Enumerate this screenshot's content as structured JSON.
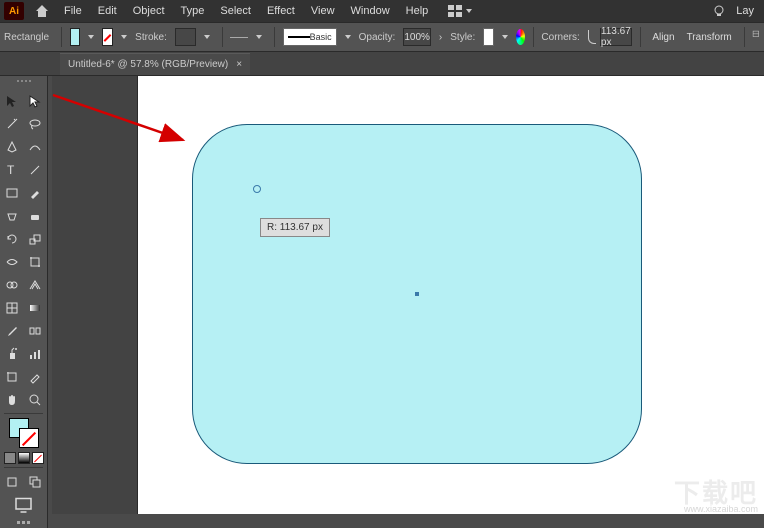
{
  "app": {
    "logo": "Ai"
  },
  "menu": {
    "items": [
      "File",
      "Edit",
      "Object",
      "Type",
      "Select",
      "Effect",
      "View",
      "Window",
      "Help"
    ],
    "right": {
      "layout": "Lay"
    }
  },
  "controlbar": {
    "shape_label": "Rectangle",
    "stroke_label": "Stroke:",
    "stroke_width": "",
    "brush_basic": "Basic",
    "opacity_label": "Opacity:",
    "opacity_value": "100%",
    "style_label": "Style:",
    "corners_label": "Corners:",
    "corners_value": "113.67 px",
    "align_label": "Align",
    "transform_label": "Transform"
  },
  "document": {
    "tab_title": "Untitled-6* @ 57.8% (RGB/Preview)",
    "tab_close": "×"
  },
  "canvas": {
    "radius_tooltip": "R: 113.67 px"
  },
  "watermark": {
    "text": "下载吧",
    "url": "www.xiazaiba.com"
  },
  "colors": {
    "fill": "#b3f0f2"
  }
}
